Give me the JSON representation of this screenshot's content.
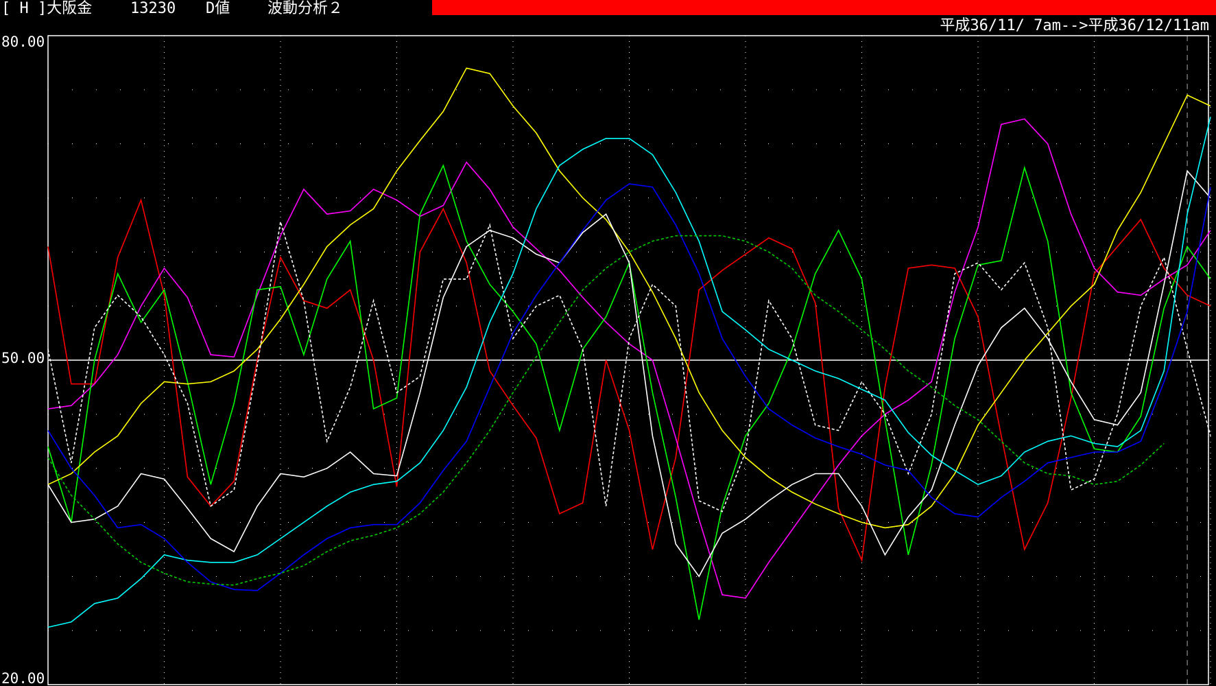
{
  "header": {
    "label": "[ H ]大阪金",
    "price": "13230",
    "value_type": "D値",
    "analysis": "波動分析２",
    "date_range": "平成36/11/ 7am-->平成36/12/11am"
  },
  "colors": {
    "background": "#000000",
    "alert_bar": "#ff0000",
    "frame": "#ffffff",
    "grid": "#ffffff"
  },
  "chart_data": {
    "type": "line",
    "x": [
      1,
      2,
      3,
      4,
      5,
      6,
      7,
      8,
      9,
      10,
      11,
      12,
      13,
      14,
      15,
      16,
      17,
      18,
      19,
      20,
      21,
      22,
      23,
      24,
      25,
      26,
      27,
      28,
      29,
      30,
      31,
      32,
      33,
      34,
      35,
      36,
      37,
      38,
      39,
      40,
      41,
      42,
      43,
      44,
      45,
      46,
      47,
      48,
      49,
      50,
      51
    ],
    "ylim": [
      20,
      80
    ],
    "yticks": [
      "80.00",
      "50.00",
      "20.00"
    ],
    "midline": 50,
    "series": [
      {
        "color": "#ff0000",
        "style": "solid",
        "values": [
          60.5,
          47.8,
          47.8,
          59.5,
          64.8,
          56,
          39.2,
          36.5,
          38.8,
          50,
          59.5,
          55.5,
          54.8,
          56.5,
          50,
          38.3,
          60,
          64,
          59,
          49,
          45.8,
          42.8,
          35.8,
          36.8,
          50,
          43.5,
          32.5,
          41,
          56.5,
          58.3,
          59.8,
          61.3,
          60.3,
          55.3,
          36.3,
          31.5,
          47.5,
          58.5,
          58.8,
          58.5,
          54,
          43,
          32.5,
          36.8,
          46.5,
          58,
          60.5,
          63,
          58.5,
          56,
          55
        ]
      },
      {
        "color": "#ff00ff",
        "style": "solid",
        "values": [
          45.5,
          45.8,
          47.8,
          50.5,
          55,
          58.5,
          55.8,
          50.5,
          50.3,
          56,
          61.5,
          65.8,
          63.5,
          63.8,
          65.8,
          64.8,
          63.3,
          64.3,
          68.3,
          65.8,
          62.3,
          60.3,
          58.3,
          55.8,
          53.5,
          51.5,
          50,
          42.8,
          35.3,
          28.3,
          28,
          31.3,
          34.3,
          37.3,
          40.3,
          43,
          45,
          46.3,
          48,
          56.3,
          62.3,
          71.8,
          72.3,
          70,
          63.5,
          58.5,
          56.3,
          56,
          57.5,
          58.8,
          62
        ]
      },
      {
        "color": "#00ff00",
        "style": "solid",
        "values": [
          42,
          35,
          50,
          58,
          53.5,
          56.5,
          48,
          38.5,
          46,
          56.5,
          56.8,
          50.5,
          57.5,
          61,
          45.5,
          46.5,
          63.5,
          68,
          61,
          57,
          54.5,
          51.5,
          43.5,
          51,
          54,
          59,
          47,
          37.3,
          26,
          36.5,
          43,
          46,
          51,
          58,
          62,
          57.5,
          44.5,
          32,
          40.3,
          52,
          58.8,
          59.2,
          67.8,
          61,
          47,
          41.8,
          41.5,
          44.8,
          54.8,
          60.5,
          57.5
        ]
      },
      {
        "color": "#ffff00",
        "style": "solid",
        "values": [
          38.5,
          39.5,
          41.5,
          43,
          46,
          48,
          47.8,
          48,
          49,
          51,
          53.8,
          57,
          60.5,
          62.5,
          64,
          67.5,
          70.3,
          73,
          77,
          76.5,
          73.5,
          71,
          67.5,
          65,
          63,
          60,
          56.3,
          52,
          47,
          43.5,
          41,
          39.2,
          37.8,
          36.7,
          35.8,
          35,
          34.5,
          34.8,
          36.5,
          39.5,
          44,
          47,
          50,
          52.5,
          55,
          57,
          62,
          65.5,
          70,
          74.5,
          73.5
        ]
      },
      {
        "color": "#ffffff",
        "style": "solid",
        "values": [
          38.5,
          35,
          35.3,
          36.5,
          39.5,
          39,
          36.3,
          33.5,
          32.3,
          36.5,
          39.5,
          39.2,
          40,
          41.5,
          39.5,
          39.3,
          47,
          55.8,
          60.5,
          62,
          61.3,
          59.8,
          59,
          61.8,
          63.5,
          59,
          43,
          33,
          30,
          34,
          35.3,
          37,
          38.5,
          39.5,
          39.5,
          36.5,
          32,
          35.5,
          38,
          44,
          49.5,
          53,
          54.8,
          52,
          48,
          44.5,
          44,
          47,
          57,
          67.5,
          65
        ]
      },
      {
        "color": "#ffffff",
        "style": "dashed",
        "values": [
          51,
          40.5,
          53,
          56,
          54,
          50.5,
          46,
          36.5,
          38,
          49.5,
          62.8,
          55.5,
          42.5,
          47.5,
          55.5,
          47,
          48.5,
          57.5,
          57.5,
          62.5,
          52,
          55,
          56,
          51,
          36.5,
          52,
          57,
          55,
          37,
          36,
          41.5,
          55.5,
          52,
          44,
          43.5,
          48,
          45,
          39.5,
          45,
          58,
          59,
          56.5,
          59,
          53,
          38,
          39,
          45,
          55,
          59.5,
          51,
          43
        ]
      },
      {
        "color": "#00ffff",
        "style": "solid",
        "values": [
          25.3,
          25.8,
          27.5,
          28,
          29.8,
          32,
          31.5,
          31.3,
          31.3,
          32,
          33.5,
          35,
          36.5,
          37.8,
          38.5,
          38.8,
          40.5,
          43.5,
          47.5,
          53.5,
          58,
          64,
          68,
          69.5,
          70.5,
          70.5,
          69,
          65.5,
          61,
          54.5,
          52.8,
          51,
          50,
          49,
          48.3,
          47.3,
          46.3,
          43.3,
          41.2,
          39.8,
          38.5,
          39.3,
          41.5,
          42.5,
          43,
          42.3,
          42,
          43.5,
          49,
          63.5,
          72.5
        ]
      },
      {
        "color": "#0000ff",
        "style": "solid",
        "values": [
          43.5,
          40,
          37.5,
          34.5,
          34.8,
          33.5,
          31.3,
          29.5,
          28.8,
          28.7,
          30.3,
          32,
          33.5,
          34.5,
          34.8,
          34.8,
          36.8,
          39.8,
          42.5,
          47.5,
          52.5,
          56,
          59,
          62,
          64.8,
          66.3,
          66,
          62.5,
          58,
          52,
          48.5,
          45.5,
          44,
          42.8,
          42,
          41.3,
          40.3,
          39.8,
          37.3,
          35.8,
          35.5,
          37.3,
          38.8,
          40.5,
          41,
          41.5,
          41.5,
          42.5,
          48,
          54.5,
          66
        ]
      },
      {
        "color": "#00cc00",
        "style": "dashed",
        "values": [
          41,
          37.5,
          35.3,
          33,
          31.3,
          30.3,
          29.5,
          29.3,
          29.2,
          29.8,
          30.3,
          31,
          32.3,
          33.3,
          33.8,
          34.5,
          35.8,
          37.8,
          40.5,
          43.5,
          47,
          50.3,
          53.5,
          56.5,
          58.5,
          60,
          61,
          61.5,
          61.5,
          61.5,
          61,
          60,
          58.5,
          56,
          54.5,
          52.8,
          51,
          49,
          47.5,
          45.8,
          44.5,
          42.5,
          40.5,
          39.5,
          39.3,
          38.5,
          38.8,
          40.3,
          42.3
        ]
      }
    ]
  }
}
